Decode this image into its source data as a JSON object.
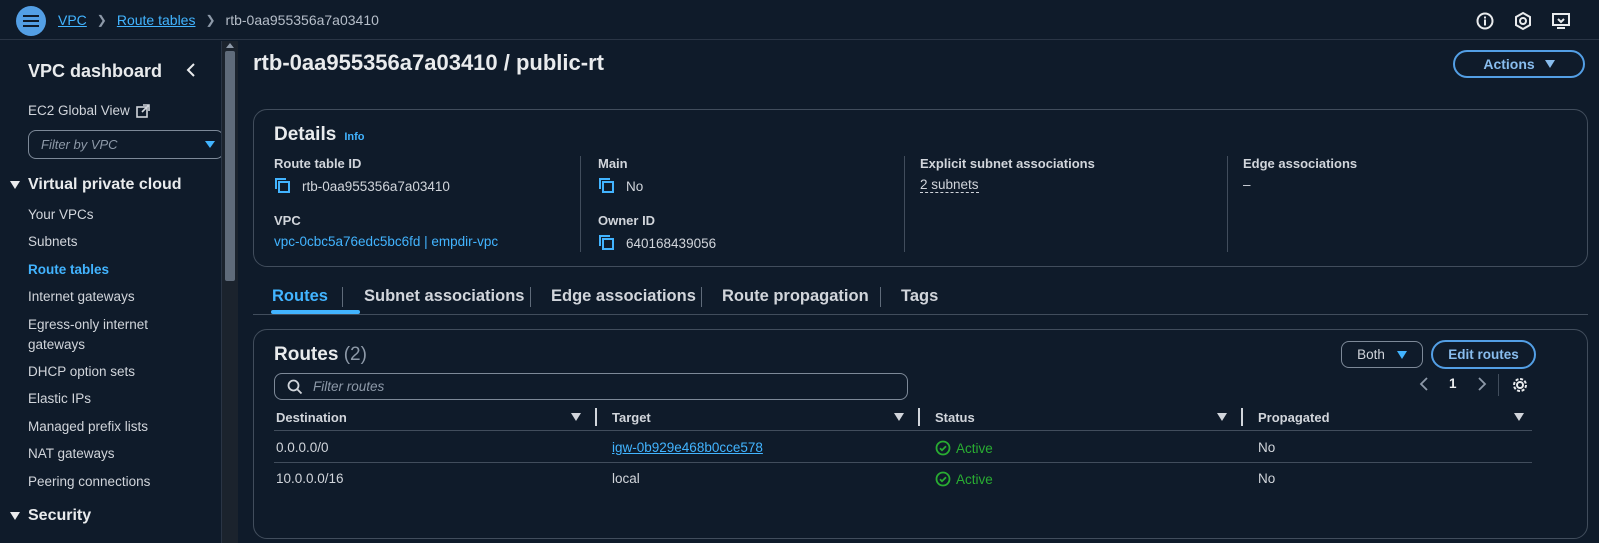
{
  "breadcrumb": {
    "items": [
      "VPC",
      "Route tables"
    ],
    "current": "rtb-0aa955356a7a03410"
  },
  "sidebar": {
    "title": "VPC dashboard",
    "global_view": "EC2 Global View",
    "filter_placeholder": "Filter by VPC",
    "section1": "Virtual private cloud",
    "items": [
      "Your VPCs",
      "Subnets",
      "Route tables",
      "Internet gateways",
      "Egress-only internet gateways",
      "DHCP option sets",
      "Elastic IPs",
      "Managed prefix lists",
      "NAT gateways",
      "Peering connections"
    ],
    "active_item": "Route tables",
    "section2": "Security"
  },
  "page": {
    "title": "rtb-0aa955356a7a03410 / public-rt",
    "actions_label": "Actions"
  },
  "details": {
    "heading": "Details",
    "info": "Info",
    "route_table_id_label": "Route table ID",
    "route_table_id": "rtb-0aa955356a7a03410",
    "vpc_label": "VPC",
    "vpc": "vpc-0cbc5a76edc5bc6fd | empdir-vpc",
    "main_label": "Main",
    "main": "No",
    "owner_id_label": "Owner ID",
    "owner_id": "640168439056",
    "explicit_label": "Explicit subnet associations",
    "explicit": "2 subnets",
    "edge_label": "Edge associations",
    "edge": "–"
  },
  "tabs": [
    "Routes",
    "Subnet associations",
    "Edge associations",
    "Route propagation",
    "Tags"
  ],
  "routes": {
    "heading": "Routes",
    "count": "(2)",
    "filter_select": "Both",
    "edit_label": "Edit routes",
    "search_placeholder": "Filter routes",
    "page": "1",
    "columns": [
      "Destination",
      "Target",
      "Status",
      "Propagated"
    ],
    "rows": [
      {
        "destination": "0.0.0.0/0",
        "target": "igw-0b929e468b0cce578",
        "status": "Active",
        "propagated": "No"
      },
      {
        "destination": "10.0.0.0/16",
        "target": "local",
        "status": "Active",
        "propagated": "No"
      }
    ]
  },
  "colors": {
    "accent": "#42b4ff",
    "success": "#29ad32",
    "background": "#0f1b2a"
  }
}
